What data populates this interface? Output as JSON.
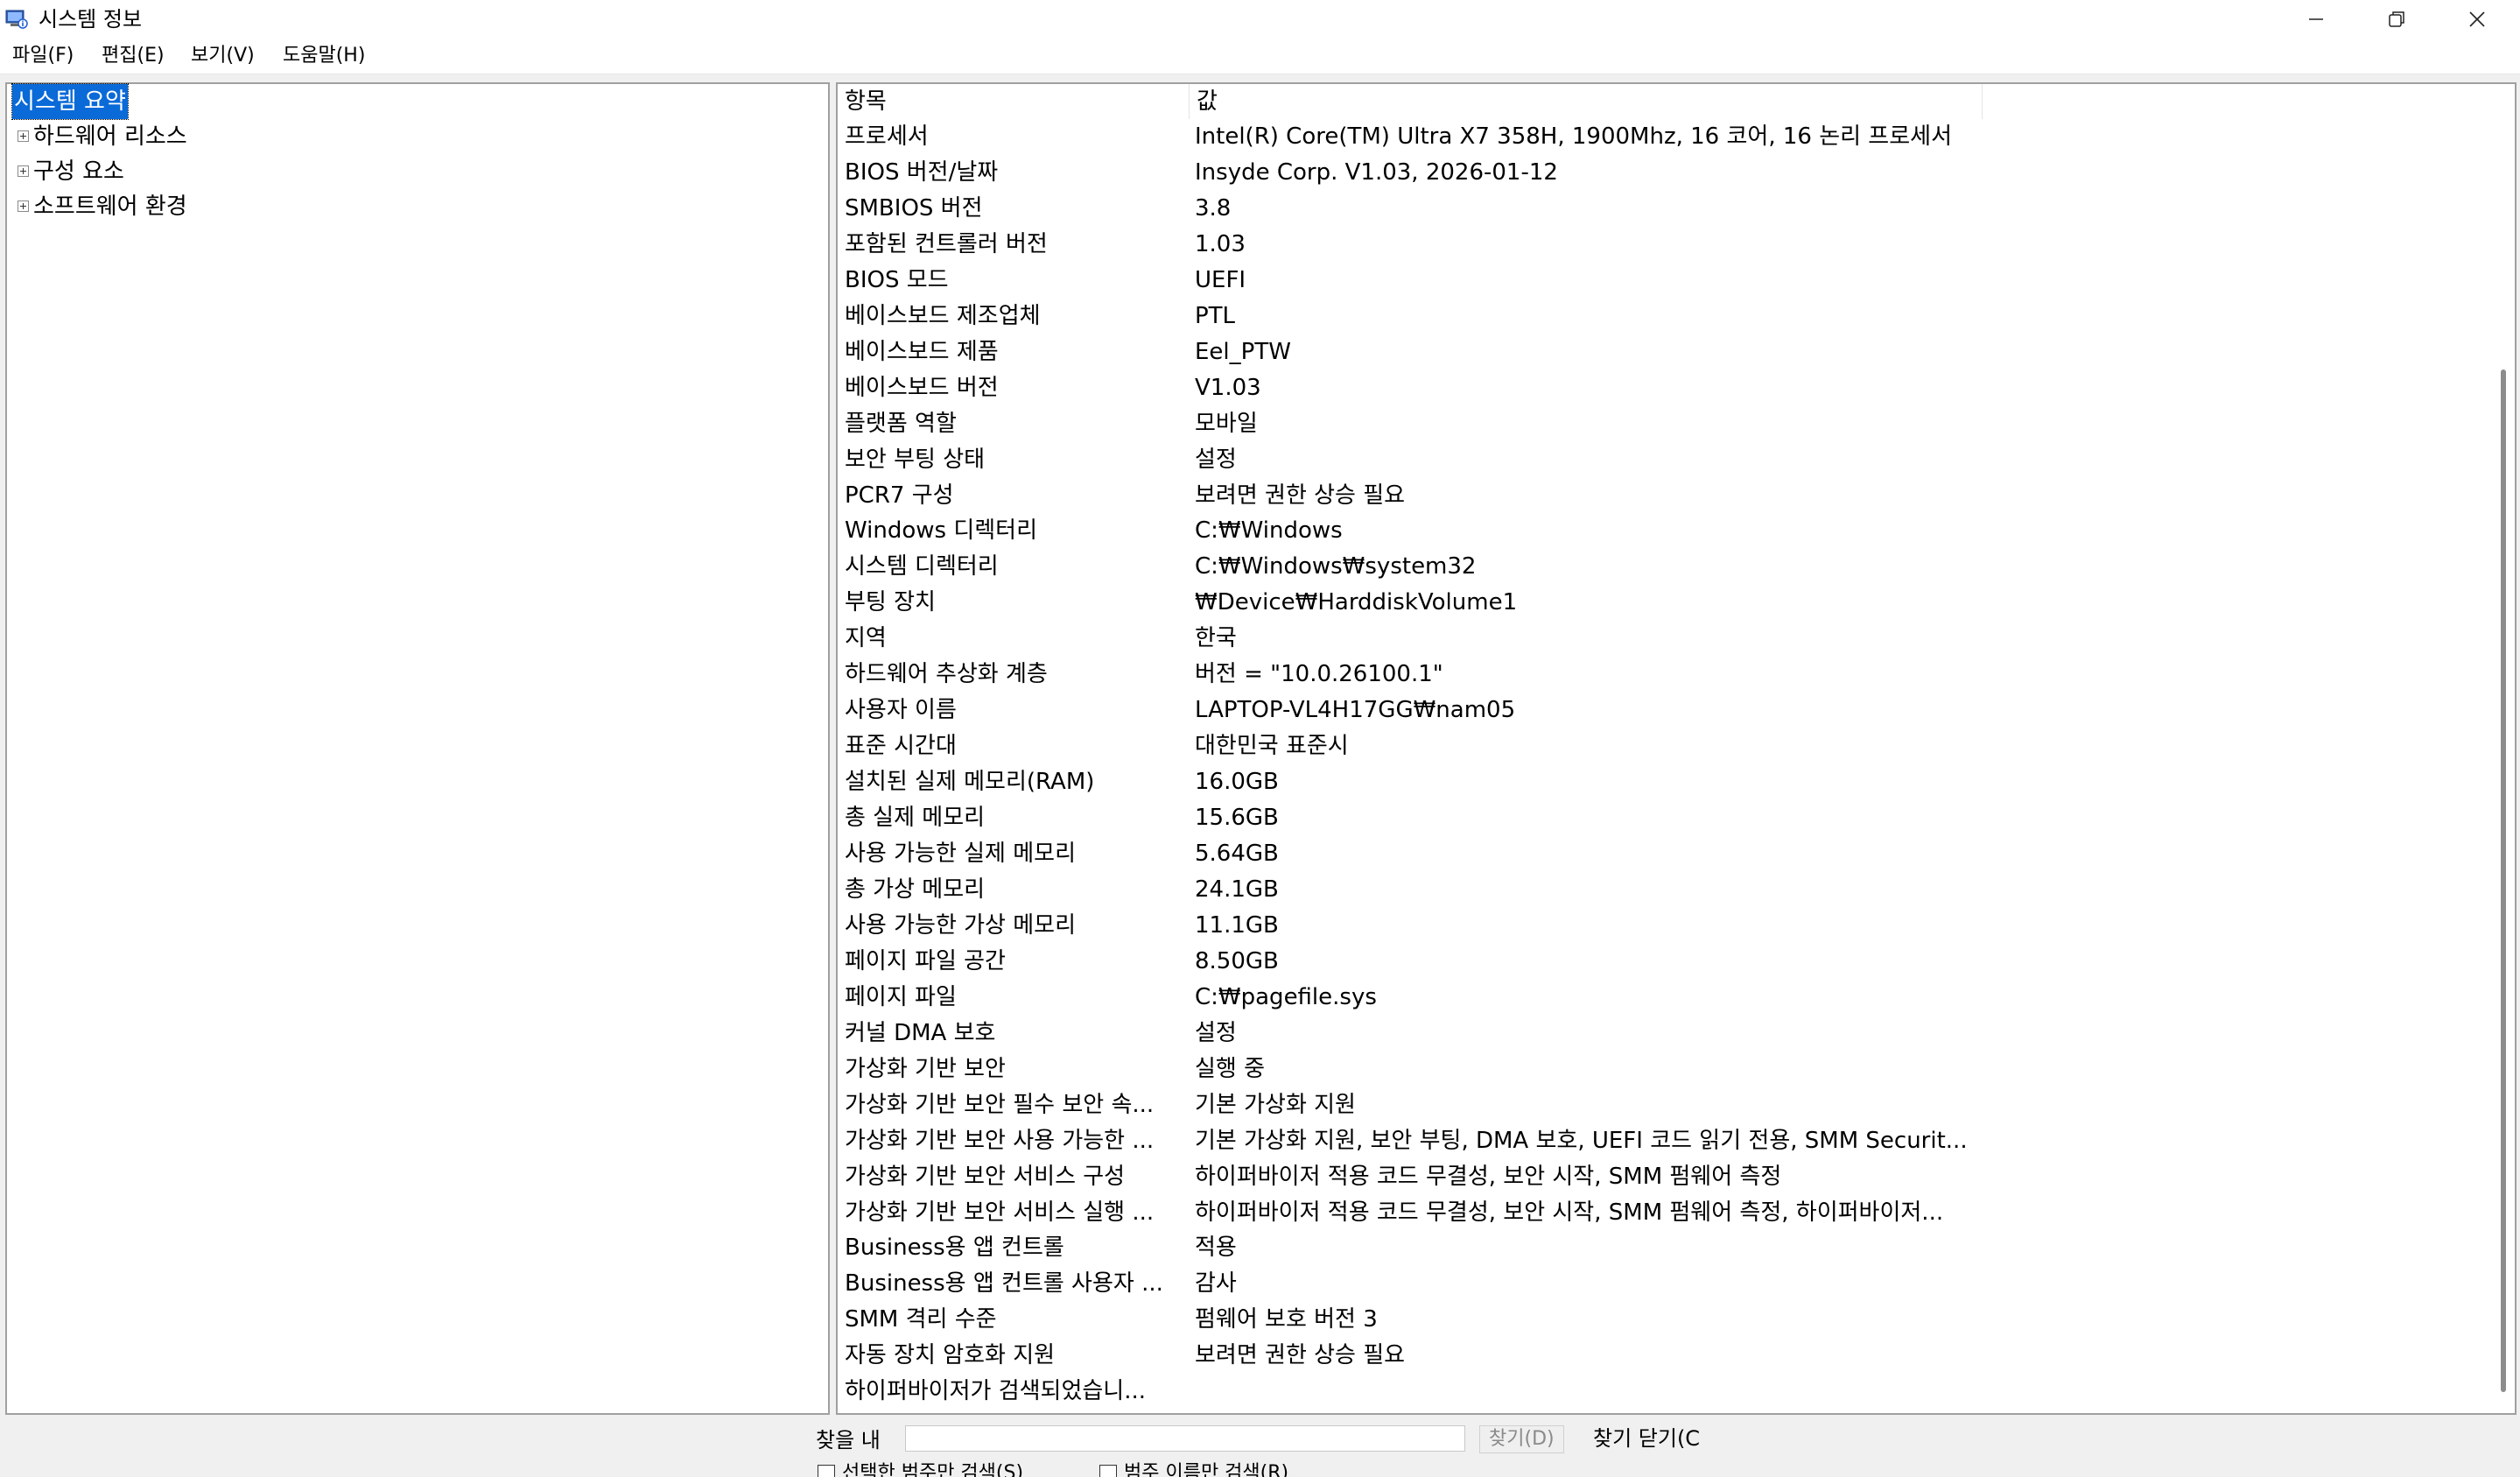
{
  "window": {
    "title": "시스템 정보"
  },
  "menu": {
    "file": "파일(F)",
    "edit": "편집(E)",
    "view": "보기(V)",
    "help": "도움말(H)"
  },
  "tree": {
    "items": [
      {
        "label": "시스템 요약",
        "selected": true
      },
      {
        "label": "하드웨어 리소스"
      },
      {
        "label": "구성 요소"
      },
      {
        "label": "소프트웨어 환경"
      }
    ]
  },
  "table": {
    "headers": [
      "항목",
      "값"
    ],
    "rows": [
      [
        "프로세서",
        "Intel(R) Core(TM) Ultra X7 358H, 1900Mhz, 16 코어, 16 논리 프로세서"
      ],
      [
        "BIOS 버전/날짜",
        "Insyde Corp. V1.03, 2026-01-12"
      ],
      [
        "SMBIOS 버전",
        "3.8"
      ],
      [
        "포함된 컨트롤러 버전",
        "1.03"
      ],
      [
        "BIOS 모드",
        "UEFI"
      ],
      [
        "베이스보드 제조업체",
        "PTL"
      ],
      [
        "베이스보드 제품",
        "Eel_PTW"
      ],
      [
        "베이스보드 버전",
        "V1.03"
      ],
      [
        "플랫폼 역할",
        "모바일"
      ],
      [
        "보안 부팅 상태",
        "설정"
      ],
      [
        "PCR7 구성",
        "보려면 권한 상승 필요"
      ],
      [
        "Windows 디렉터리",
        "C:₩Windows"
      ],
      [
        "시스템 디렉터리",
        "C:₩Windows₩system32"
      ],
      [
        "부팅 장치",
        "₩Device₩HarddiskVolume1"
      ],
      [
        "지역",
        "한국"
      ],
      [
        "하드웨어 추상화 계층",
        "버전 = \"10.0.26100.1\""
      ],
      [
        "사용자 이름",
        "LAPTOP-VL4H17GG₩nam05"
      ],
      [
        "표준 시간대",
        "대한민국 표준시"
      ],
      [
        "설치된 실제 메모리(RAM)",
        "16.0GB"
      ],
      [
        "총 실제 메모리",
        "15.6GB"
      ],
      [
        "사용 가능한 실제 메모리",
        "5.64GB"
      ],
      [
        "총 가상 메모리",
        "24.1GB"
      ],
      [
        "사용 가능한 가상 메모리",
        "11.1GB"
      ],
      [
        "페이지 파일 공간",
        "8.50GB"
      ],
      [
        "페이지 파일",
        "C:₩pagefile.sys"
      ],
      [
        "커널 DMA 보호",
        "설정"
      ],
      [
        "가상화 기반 보안",
        "실행 중"
      ],
      [
        "가상화 기반 보안 필수 보안 속...",
        "기본 가상화 지원"
      ],
      [
        "가상화 기반 보안 사용 가능한 ...",
        "기본 가상화 지원, 보안 부팅, DMA 보호, UEFI 코드 읽기 전용, SMM Securit..."
      ],
      [
        "가상화 기반 보안 서비스 구성",
        "하이퍼바이저 적용 코드 무결성, 보안 시작, SMM 펌웨어 측정"
      ],
      [
        "가상화 기반 보안 서비스 실행 ...",
        "하이퍼바이저 적용 코드 무결성, 보안 시작, SMM 펌웨어 측정, 하이퍼바이저..."
      ],
      [
        "Business용 앱 컨트롤",
        "적용"
      ],
      [
        "Business용 앱 컨트롤 사용자 ...",
        "감사"
      ],
      [
        "SMM 격리 수준",
        "펌웨어 보호 버전 3"
      ],
      [
        "자동 장치 암호화 지원",
        "보려면 권한 상승 필요"
      ],
      [
        "하이퍼바이저가 검색되었습니...",
        ""
      ]
    ]
  },
  "find": {
    "label": "찾을 내",
    "find_button": "찾기(D)",
    "close_button": "찾기 닫기(C",
    "selected_category_only": "선택한 범주만 검색(S)",
    "category_names_only": "범주 이름만 검색(R)"
  },
  "icons": {
    "app": "system-info-icon",
    "minimize": "minimize-icon",
    "maximize": "restore-icon",
    "close": "close-icon"
  }
}
